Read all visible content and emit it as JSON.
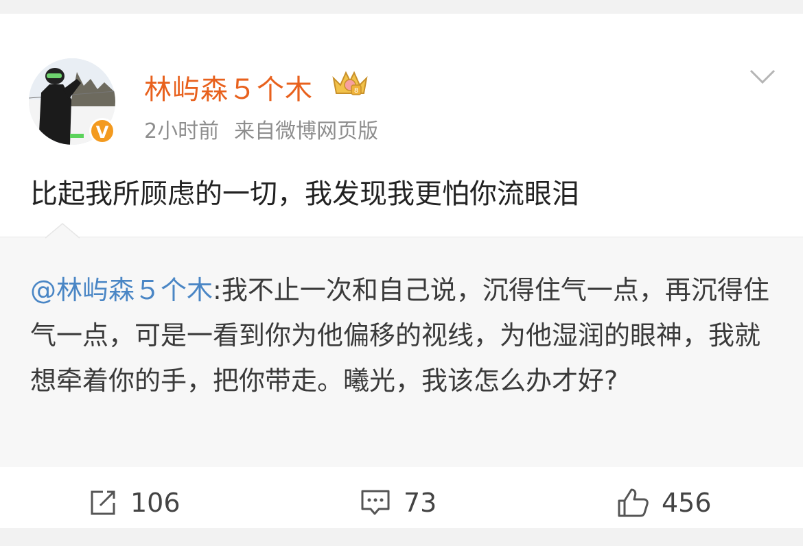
{
  "post": {
    "author": "林屿森５个木",
    "time": "2小时前",
    "source": "来自微博网页版",
    "text": "比起我所顾虑的一切，我发现我更怕你流眼泪",
    "verified_badge": "V"
  },
  "quote": {
    "mention": "@林屿森５个木",
    "text": ":我不止一次和自己说，沉得住气一点，再沉得住气一点，可是一看到你为他偏移的视线，为他湿润的眼神，我就想牵着你的手，把你带走。曦光，我该怎么办才好?"
  },
  "actions": {
    "repost_count": "106",
    "comment_count": "73",
    "like_count": "456",
    "repost_icon": "repost-icon",
    "comment_icon": "comment-icon",
    "like_icon": "thumbs-up-icon"
  },
  "colors": {
    "username": "#e8611d",
    "mention": "#4a86c5",
    "badge": "#f39a1f",
    "meta": "#8e8e8e"
  }
}
